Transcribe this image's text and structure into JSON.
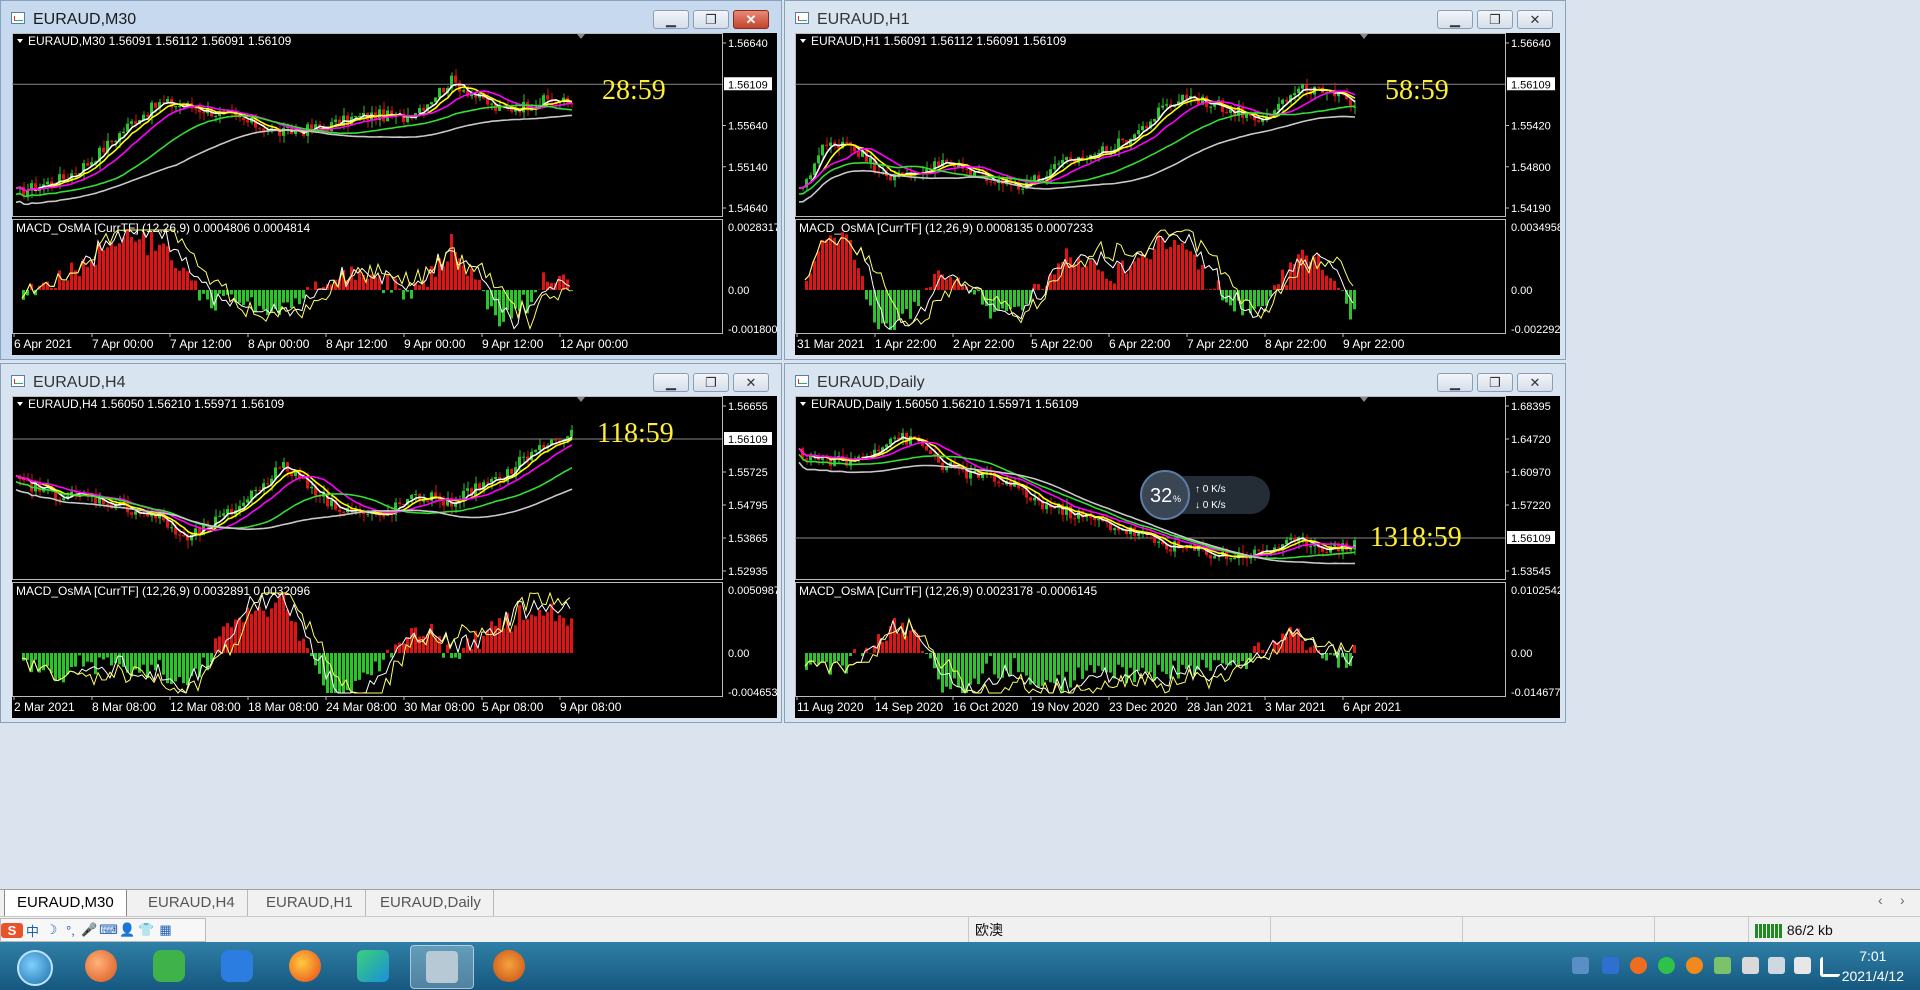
{
  "windows": [
    {
      "key": "m30",
      "title": "EURAUD,M30",
      "header": "EURAUD,M30  1.56091 1.56112 1.56091 1.56109",
      "price_labels": [
        "1.56640",
        "1.56109",
        "1.55640",
        "1.55140",
        "1.54640"
      ],
      "current_price": "1.56109",
      "timer": "28:59",
      "macd_header": "MACD_OsMA [CurrTF] (12,26,9) 0.0004806 0.0004814",
      "macd_labels": [
        "0.0028317",
        "0.00",
        "-0.0018002"
      ],
      "time_labels": [
        "6 Apr 2021",
        "7 Apr 00:00",
        "7 Apr 12:00",
        "8 Apr 00:00",
        "8 Apr 12:00",
        "9 Apr 00:00",
        "9 Apr 12:00",
        "12 Apr 00:00"
      ]
    },
    {
      "key": "h1",
      "title": "EURAUD,H1",
      "header": "EURAUD,H1  1.56091 1.56112 1.56091 1.56109",
      "price_labels": [
        "1.56640",
        "1.56109",
        "1.55420",
        "1.54800",
        "1.54190"
      ],
      "current_price": "1.56109",
      "timer": "58:59",
      "macd_header": "MACD_OsMA [CurrTF] (12,26,9) 0.0008135 0.0007233",
      "macd_labels": [
        "0.0034958",
        "0.00",
        "-0.0022927"
      ],
      "time_labels": [
        "31 Mar 2021",
        "1 Apr 22:00",
        "2 Apr 22:00",
        "5 Apr 22:00",
        "6 Apr 22:00",
        "7 Apr 22:00",
        "8 Apr 22:00",
        "9 Apr 22:00"
      ]
    },
    {
      "key": "h4",
      "title": "EURAUD,H4",
      "header": "EURAUD,H4  1.56050 1.56210 1.55971 1.56109",
      "price_labels": [
        "1.56655",
        "1.56109",
        "1.55725",
        "1.54795",
        "1.53865",
        "1.52935"
      ],
      "current_price": "1.56109",
      "timer": "118:59",
      "macd_header": "MACD_OsMA [CurrTF] (12,26,9) 0.0032891 0.0032096",
      "macd_labels": [
        "0.0050987",
        "0.00",
        "-0.0046533"
      ],
      "time_labels": [
        "2 Mar 2021",
        "8 Mar 08:00",
        "12 Mar 08:00",
        "18 Mar 08:00",
        "24 Mar 08:00",
        "30 Mar 08:00",
        "5 Apr 08:00",
        "9 Apr 08:00"
      ]
    },
    {
      "key": "daily",
      "title": "EURAUD,Daily",
      "header": "EURAUD,Daily  1.56050 1.56210 1.55971 1.56109",
      "price_labels": [
        "1.68395",
        "1.64720",
        "1.60970",
        "1.57220",
        "1.56109",
        "1.53545"
      ],
      "current_price": "1.56109",
      "timer": "1318:59",
      "macd_header": "MACD_OsMA [CurrTF] (12,26,9) 0.0023178 -0.0006145",
      "macd_labels": [
        "0.0102542",
        "0.00",
        "-0.0146778"
      ],
      "time_labels": [
        "11 Aug 2020",
        "14 Sep 2020",
        "16 Oct 2020",
        "19 Nov 2020",
        "23 Dec 2020",
        "28 Jan 2021",
        "3 Mar 2021",
        "6 Apr 2021"
      ],
      "overlay": {
        "percent": "32",
        "percent_unit": "%",
        "up_speed": "0",
        "down_speed": "0",
        "speed_unit": "K/s"
      }
    }
  ],
  "tabs": [
    "EURAUD,M30",
    "EURAUD,H4",
    "EURAUD,H1",
    "EURAUD,Daily"
  ],
  "status": {
    "market_name": "欧澳",
    "traffic": "86/2 kb"
  },
  "ime": {
    "chars": [
      "中",
      "☽",
      "°,",
      "🎤",
      "⌨",
      "👤",
      "👕",
      "▦"
    ]
  },
  "clock": {
    "time": "7:01",
    "date": "2021/4/12"
  },
  "colors": {
    "bull": "#2bc42b",
    "bear": "#e01414",
    "ema_fast": "#ffffff",
    "ema_mid": "#ffff00",
    "ema_slow": "#ff00ff",
    "ma_green": "#33dd33",
    "ma_gray": "#c8c8c8",
    "timer": "#ffee33"
  }
}
